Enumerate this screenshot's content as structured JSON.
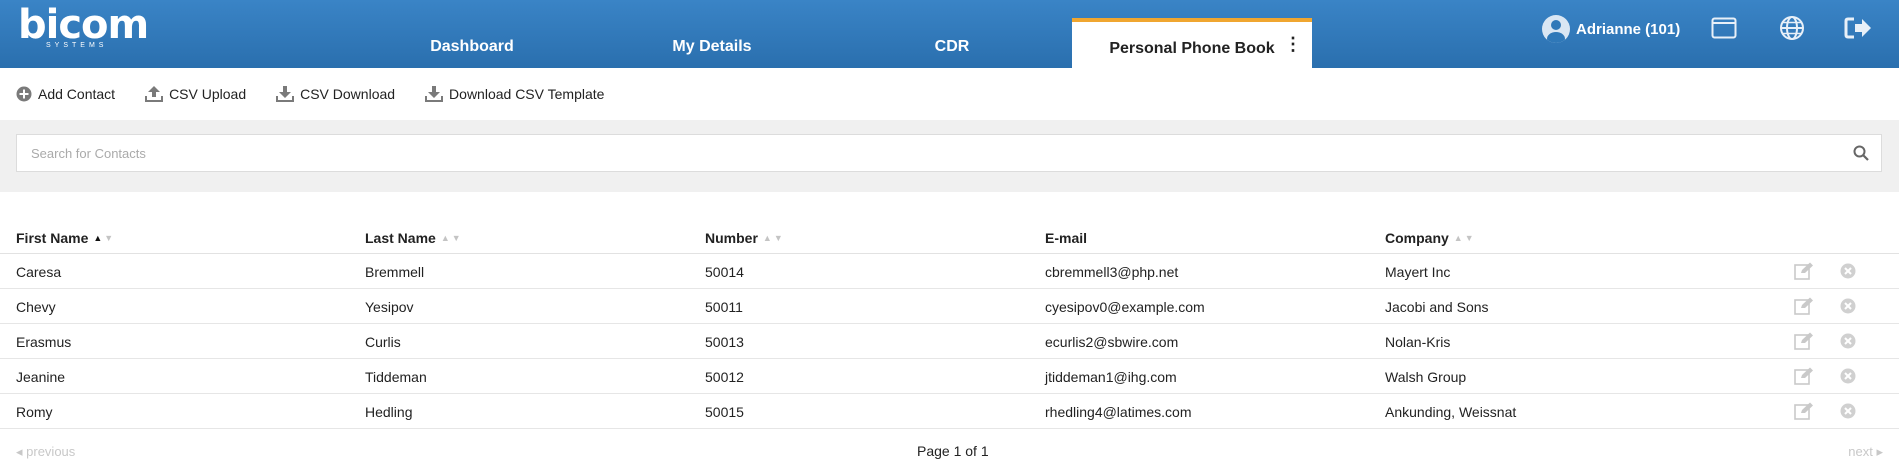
{
  "header": {
    "logo_text": "bicom",
    "logo_sub": "SYSTEMS",
    "tabs": [
      {
        "label": "Dashboard"
      },
      {
        "label": "My Details"
      },
      {
        "label": "CDR"
      },
      {
        "label": "Personal Phone Book"
      }
    ],
    "active_tab": "Personal Phone Book",
    "user_label": "Adrianne (101)",
    "icons": [
      "window-icon",
      "globe-icon",
      "logout-icon"
    ],
    "accent_color": "#f0a630",
    "bar_color": "#2f78b8"
  },
  "toolbar": {
    "add_contact": "Add Contact",
    "csv_upload": "CSV Upload",
    "csv_download": "CSV Download",
    "download_template": "Download CSV Template"
  },
  "search": {
    "placeholder": "Search for Contacts",
    "value": ""
  },
  "table": {
    "columns": [
      "First Name",
      "Last Name",
      "Number",
      "E-mail",
      "Company"
    ],
    "sorted_by": "First Name",
    "sort_direction": "ascending",
    "rows": [
      {
        "first": "Caresa",
        "last": "Bremmell",
        "number": "50014",
        "email": "cbremmell3@php.net",
        "company": "Mayert Inc"
      },
      {
        "first": "Chevy",
        "last": "Yesipov",
        "number": "50011",
        "email": "cyesipov0@example.com",
        "company": "Jacobi and Sons"
      },
      {
        "first": "Erasmus",
        "last": "Curlis",
        "number": "50013",
        "email": "ecurlis2@sbwire.com",
        "company": "Nolan-Kris"
      },
      {
        "first": "Jeanine",
        "last": "Tiddeman",
        "number": "50012",
        "email": "jtiddeman1@ihg.com",
        "company": "Walsh Group"
      },
      {
        "first": "Romy",
        "last": "Hedling",
        "number": "50015",
        "email": "rhedling4@latimes.com",
        "company": "Ankunding, Weissnat"
      }
    ]
  },
  "pager": {
    "previous": "previous",
    "info": "Page 1 of 1",
    "next": "next"
  }
}
